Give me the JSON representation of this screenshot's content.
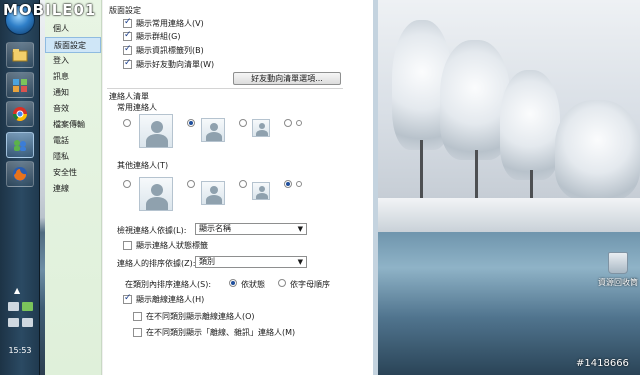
{
  "logo": {
    "text": "MOBILE01"
  },
  "taskbar": {
    "clock": "15:53",
    "buttons": [
      "explorer",
      "control-panel",
      "chrome",
      "messenger",
      "firefox"
    ]
  },
  "window": {
    "nav": {
      "items": [
        {
          "label": "個人"
        },
        {
          "label": "版面設定",
          "selected": true
        },
        {
          "label": "登入"
        },
        {
          "label": "訊息"
        },
        {
          "label": "通知"
        },
        {
          "label": "音效"
        },
        {
          "label": "檔案傳輸"
        },
        {
          "label": "電話"
        },
        {
          "label": "隱私"
        },
        {
          "label": "安全性"
        },
        {
          "label": "連線"
        }
      ]
    },
    "main": {
      "section1_title": "版面設定",
      "checkboxes": [
        {
          "label": "顯示常用連絡人(V)",
          "checked": true
        },
        {
          "label": "顯示群組(G)",
          "checked": true
        },
        {
          "label": "顯示資訊標籤列(B)",
          "checked": true
        },
        {
          "label": "顯示好友動向清單(W)",
          "checked": true
        }
      ],
      "friends_button": "好友動向清單選項...",
      "contact_list_title": "連絡人清單",
      "favorites_title": "常用連絡人",
      "others_title": "其他連絡人(T)",
      "view_by_label": "檢視連絡人依據(L):",
      "view_by_value": "顯示名稱",
      "show_status_label": "顯示連絡人狀態標籤",
      "sort_by_label": "連絡人的排序依據(Z):",
      "sort_by_value": "類別",
      "sort_in_category_label": "在類別內排序連絡人(S):",
      "sort_option_status": "依狀態",
      "sort_option_alpha": "依字母順序",
      "show_offline_label": "顯示離線連絡人(H)",
      "offline_sub1": "在不同類別顯示離線連絡人(O)",
      "offline_sub2": "在不同類別顯示「離線、雜訊」連絡人(M)"
    }
  },
  "desktop": {
    "recycle_bin_label": "資源回收筒",
    "watermark": "#1418666"
  },
  "colors": {
    "nav_bg": "#e4f3e0",
    "selection": "#cfe6f7",
    "taskbar": "#2b4a63"
  }
}
